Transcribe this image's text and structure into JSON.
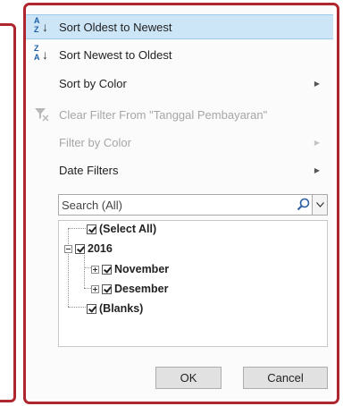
{
  "menu": {
    "items": [
      {
        "label": "Sort Oldest to Newest",
        "icon": "sort-ascending-icon",
        "highlighted": true,
        "disabled": false,
        "submenu": false
      },
      {
        "label": "Sort Newest to Oldest",
        "icon": "sort-descending-icon",
        "highlighted": false,
        "disabled": false,
        "submenu": false
      },
      {
        "label": "Sort by Color",
        "icon": "",
        "highlighted": false,
        "disabled": false,
        "submenu": true
      },
      {
        "label": "Clear Filter From \"Tanggal Pembayaran\"",
        "icon": "clear-filter-icon",
        "highlighted": false,
        "disabled": true,
        "submenu": false
      },
      {
        "label": "Filter by Color",
        "icon": "",
        "highlighted": false,
        "disabled": true,
        "submenu": true
      },
      {
        "label": "Date Filters",
        "icon": "",
        "highlighted": false,
        "disabled": false,
        "submenu": true
      }
    ]
  },
  "sort_icons": {
    "asc_top": "A",
    "asc_bottom": "Z",
    "desc_top": "Z",
    "desc_bottom": "A"
  },
  "search": {
    "placeholder": "Search (All)",
    "value": ""
  },
  "tree": {
    "select_all": "(Select All)",
    "year": "2016",
    "months": [
      "November",
      "Desember"
    ],
    "blanks": "(Blanks)"
  },
  "buttons": {
    "ok": "OK",
    "cancel": "Cancel"
  },
  "colors": {
    "highlight": "#cde6f7",
    "frame": "#b0262f",
    "icon_blue": "#1d5fa8"
  }
}
